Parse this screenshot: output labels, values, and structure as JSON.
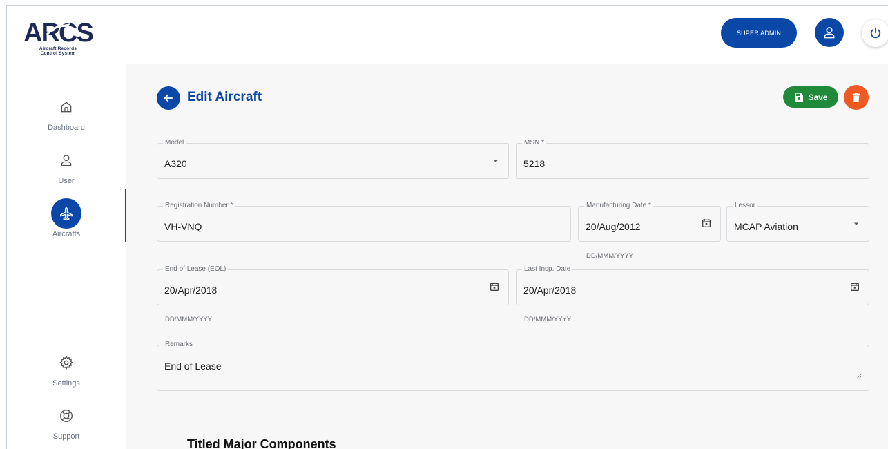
{
  "header": {
    "logo_text": "ARCS",
    "logo_subtitle_line1": "Aircraft Records",
    "logo_subtitle_line2": "Control System",
    "role_button": "SUPER ADMIN"
  },
  "sidebar": {
    "items": [
      {
        "label": "Dashboard",
        "icon": "home-icon"
      },
      {
        "label": "User",
        "icon": "user-icon"
      },
      {
        "label": "Aircrafts",
        "icon": "airplane-icon"
      },
      {
        "label": "Settings",
        "icon": "gear-icon"
      },
      {
        "label": "Support",
        "icon": "lifebuoy-icon"
      }
    ],
    "active": "Aircrafts"
  },
  "page": {
    "title": "Edit Aircraft",
    "save_label": "Save"
  },
  "form": {
    "model": {
      "label": "Model",
      "value": "A320"
    },
    "msn": {
      "label": "MSN *",
      "value": "5218"
    },
    "registration": {
      "label": "Registration Number *",
      "value": "VH-VNQ"
    },
    "manufacturing_date": {
      "label": "Manufacturing Date *",
      "value": "20/Aug/2012",
      "helper": "DD/MMM/YYYY"
    },
    "lessor": {
      "label": "Lessor",
      "value": "MCAP Aviation"
    },
    "eol": {
      "label": "End of Lease (EOL)",
      "value": "20/Apr/2018",
      "helper": "DD/MMM/YYYY"
    },
    "last_insp": {
      "label": "Last Insp. Date",
      "value": "20/Apr/2018",
      "helper": "DD/MMM/YYYY"
    },
    "remarks": {
      "label": "Remarks",
      "value": "End of Lease"
    }
  },
  "section": {
    "title": "Titled Major Components"
  },
  "colors": {
    "primary": "#0b47a6",
    "save": "#1e8a3a",
    "delete": "#f05a22"
  }
}
